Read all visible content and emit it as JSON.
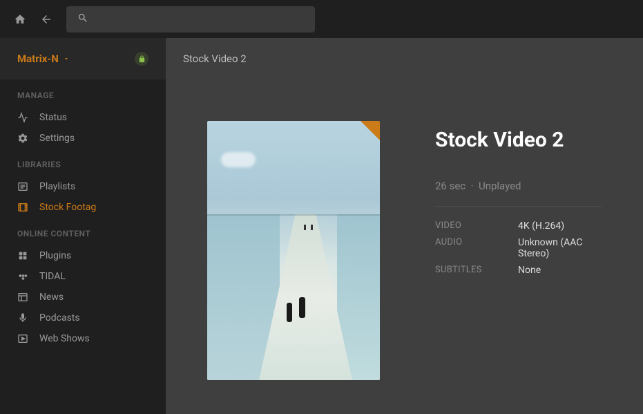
{
  "topbar": {
    "search_placeholder": ""
  },
  "sidebar": {
    "server_name": "Matrix-N",
    "sections": {
      "manage": {
        "heading": "MANAGE",
        "items": [
          {
            "label": "Status"
          },
          {
            "label": "Settings"
          }
        ]
      },
      "libraries": {
        "heading": "LIBRARIES",
        "items": [
          {
            "label": "Playlists"
          },
          {
            "label": "Stock Footag"
          }
        ]
      },
      "online": {
        "heading": "ONLINE CONTENT",
        "items": [
          {
            "label": "Plugins"
          },
          {
            "label": "TIDAL"
          },
          {
            "label": "News"
          },
          {
            "label": "Podcasts"
          },
          {
            "label": "Web Shows"
          }
        ]
      }
    }
  },
  "main": {
    "breadcrumb": "Stock Video 2",
    "title": "Stock Video 2",
    "duration": "26 sec",
    "separator": "·",
    "play_status": "Unplayed",
    "specs": {
      "video_label": "VIDEO",
      "video_value": "4K (H.264)",
      "audio_label": "AUDIO",
      "audio_value": "Unknown (AAC Stereo)",
      "subtitles_label": "SUBTITLES",
      "subtitles_value": "None"
    }
  }
}
